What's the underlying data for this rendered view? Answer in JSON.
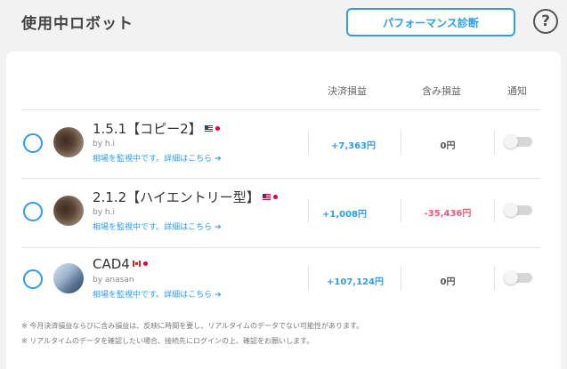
{
  "header": {
    "title": "使用中ロボット",
    "diagnosis_button": "パフォーマンス診断",
    "help_icon": "?"
  },
  "table": {
    "columns": [
      "決済損益",
      "含み損益",
      "通知"
    ],
    "rows": [
      {
        "name": "1.5.1【コピー2】",
        "flag": "us-flag-icon",
        "author": "by h.i",
        "status": "相場を監視中です。詳細はこちら",
        "realized": "+7,363円",
        "unrealized": "0円",
        "notify": false
      },
      {
        "name": "2.1.2【ハイエントリー型】",
        "flag": "us-flag-icon",
        "author": "by h.i",
        "status": "相場を監視中です。詳細はこちら",
        "realized": "+1,008円",
        "unrealized": "-35,436円",
        "notify": false
      },
      {
        "name": "CAD4",
        "flag": "ca-flag-icon",
        "author": "by anasan",
        "status": "相場を監視中です。詳細はこちら",
        "realized": "+107,124円",
        "unrealized": "0円",
        "notify": false
      }
    ]
  },
  "notes": [
    "※ 今月決済損益ならびに含み損益は、反映に時間を要し、リアルタイムのデータでない可能性があります。",
    "※ リアルタイムのデータを確認したい場合、接続先にログインの上、確認をお願いします。"
  ],
  "colors": {
    "accent": "#2e9df0",
    "positive": "#2e9df0",
    "negative": "#f0587a",
    "neutral": "#555555"
  }
}
